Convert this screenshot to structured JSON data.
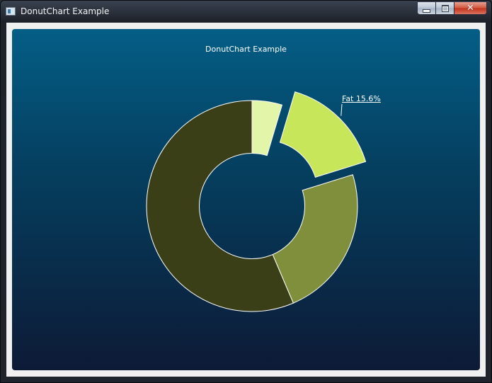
{
  "window": {
    "title": "DonutChart Example",
    "buttons": {
      "minimize": "minimize",
      "maximize": "maximize",
      "close": "close"
    }
  },
  "chart_data": {
    "type": "pie",
    "title": "DonutChart Example",
    "hole": 0.5,
    "background": [
      "#045e86",
      "#0d1a36"
    ],
    "slices": [
      {
        "value": 4.6,
        "color": "#e3f5a8",
        "label": "",
        "exploded": false
      },
      {
        "value": 15.6,
        "color": "#c8e65a",
        "label": "Fat 15.6%",
        "exploded": true,
        "label_visible": true
      },
      {
        "value": 23.4,
        "color": "#7f8f3c",
        "label": "",
        "exploded": false
      },
      {
        "value": 56.4,
        "color": "#3a3f18",
        "label": "",
        "exploded": false
      }
    ]
  }
}
